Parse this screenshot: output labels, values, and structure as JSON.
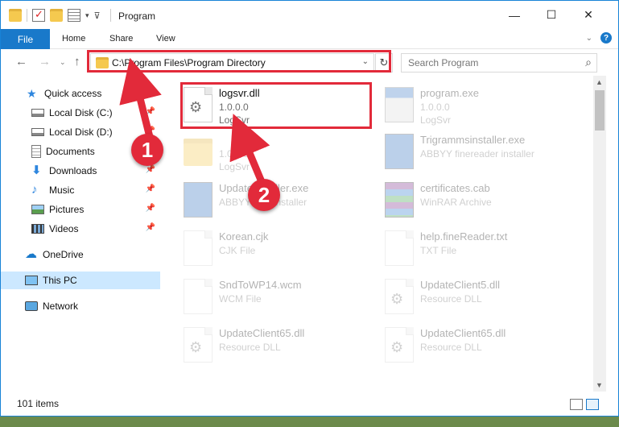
{
  "window": {
    "title": "Program"
  },
  "ribbon": {
    "tabs": [
      "File",
      "Home",
      "Share",
      "View"
    ],
    "help_glyph": "?"
  },
  "nav": {
    "address_path": "C:\\Program Files\\Program Directory",
    "search_placeholder": "Search Program"
  },
  "sidebar": {
    "items": [
      {
        "label": "Quick access",
        "icon": "star-icon",
        "pinned": false
      },
      {
        "label": "Local Disk (C:)",
        "icon": "drive-icon",
        "pinned": true
      },
      {
        "label": "Local Disk (D:)",
        "icon": "drive-icon",
        "pinned": true
      },
      {
        "label": "Documents",
        "icon": "documents-icon",
        "pinned": true
      },
      {
        "label": "Downloads",
        "icon": "download-icon",
        "pinned": true
      },
      {
        "label": "Music",
        "icon": "music-icon",
        "pinned": true
      },
      {
        "label": "Pictures",
        "icon": "pictures-icon",
        "pinned": true
      },
      {
        "label": "Videos",
        "icon": "videos-icon",
        "pinned": true
      },
      {
        "label": "OneDrive",
        "icon": "cloud-icon",
        "pinned": false
      },
      {
        "label": "This PC",
        "icon": "computer-icon",
        "pinned": false,
        "selected": true
      },
      {
        "label": "Network",
        "icon": "network-icon",
        "pinned": false
      }
    ]
  },
  "files": [
    {
      "name": "logsvr.dll",
      "line1": "1.0.0.0",
      "line2": "LogSvr",
      "icon": "dll-gear-icon"
    },
    {
      "name": "program.exe",
      "line1": "1.0.0.0",
      "line2": "LogSvr",
      "icon": "exe-icon"
    },
    {
      "name": "",
      "line1": "1.0.0.0",
      "line2": "LogSvr",
      "icon": "folder-icon"
    },
    {
      "name": "Trigrammsinstaller.exe",
      "line1": "ABBYY finereader installer",
      "line2": "",
      "icon": "installer-icon"
    },
    {
      "name": "UpdateInstaller.exe",
      "line1": "ABBYY files installer",
      "line2": "",
      "icon": "installer-icon"
    },
    {
      "name": "certificates.cab",
      "line1": "WinRAR Archive",
      "line2": "",
      "icon": "archive-icon"
    },
    {
      "name": "Korean.cjk",
      "line1": "CJK File",
      "line2": "",
      "icon": "file-icon"
    },
    {
      "name": "help.fineReader.txt",
      "line1": "TXT File",
      "line2": "",
      "icon": "file-icon"
    },
    {
      "name": "SndToWP14.wcm",
      "line1": "WCM File",
      "line2": "",
      "icon": "file-icon"
    },
    {
      "name": "UpdateClient5.dll",
      "line1": "Resource DLL",
      "line2": "",
      "icon": "dll-gear-icon"
    },
    {
      "name": "UpdateClient65.dll",
      "line1": "Resource DLL",
      "line2": "",
      "icon": "dll-gear-icon"
    },
    {
      "name": "UpdateClient65.dll",
      "line1": "Resource DLL",
      "line2": "",
      "icon": "dll-gear-icon"
    }
  ],
  "status": {
    "item_count": "101 items"
  },
  "annotations": {
    "step1": "1",
    "step2": "2",
    "color": "#e22a3a"
  }
}
